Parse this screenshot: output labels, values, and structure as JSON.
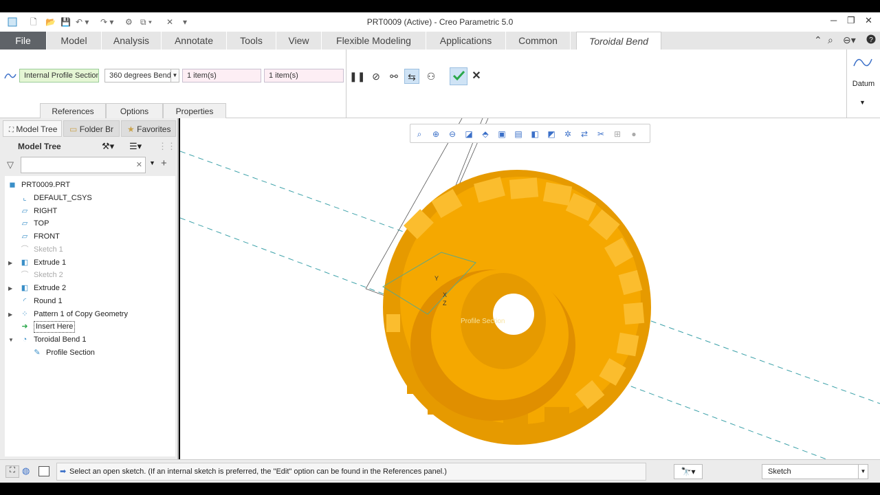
{
  "window": {
    "title": "PRT0009 (Active) - Creo Parametric 5.0"
  },
  "ribbon": {
    "file_tab": "File",
    "tabs": [
      "Model",
      "Analysis",
      "Annotate",
      "Tools",
      "View",
      "Flexible Modeling",
      "Applications",
      "Common"
    ],
    "active_tab": "Toroidal Bend"
  },
  "dashboard": {
    "profile_type": "Internal Profile Section",
    "bend_angle": "360 degrees Bend",
    "collector_1": "1 item(s)",
    "collector_2": "1 item(s)",
    "sub_tabs": [
      "References",
      "Options",
      "Properties"
    ],
    "datum_label": "Datum"
  },
  "panel": {
    "tabs": [
      "Model Tree",
      "Folder Br",
      "Favorites"
    ],
    "header": "Model Tree",
    "search_value": "",
    "tree": [
      {
        "label": "PRT0009.PRT",
        "icon": "part-icon",
        "expand": "",
        "dim": false,
        "indent": 0
      },
      {
        "label": "DEFAULT_CSYS",
        "icon": "csys-icon",
        "expand": "",
        "dim": false,
        "indent": 1
      },
      {
        "label": "RIGHT",
        "icon": "datum-plane-icon",
        "expand": "",
        "dim": false,
        "indent": 1
      },
      {
        "label": "TOP",
        "icon": "datum-plane-icon",
        "expand": "",
        "dim": false,
        "indent": 1
      },
      {
        "label": "FRONT",
        "icon": "datum-plane-icon",
        "expand": "",
        "dim": false,
        "indent": 1
      },
      {
        "label": "Sketch 1",
        "icon": "sketch-icon",
        "expand": "",
        "dim": true,
        "indent": 1
      },
      {
        "label": "Extrude 1",
        "icon": "extrude-icon",
        "expand": "▶",
        "dim": false,
        "indent": 1
      },
      {
        "label": "Sketch 2",
        "icon": "sketch-icon",
        "expand": "",
        "dim": true,
        "indent": 1
      },
      {
        "label": "Extrude 2",
        "icon": "extrude-icon",
        "expand": "▶",
        "dim": false,
        "indent": 1
      },
      {
        "label": "Round 1",
        "icon": "round-icon",
        "expand": "",
        "dim": false,
        "indent": 1
      },
      {
        "label": "Pattern 1 of Copy Geometry",
        "icon": "pattern-icon",
        "expand": "▶",
        "dim": false,
        "indent": 1
      },
      {
        "label": "Insert Here",
        "icon": "insert-arrow-icon",
        "expand": "",
        "dim": false,
        "indent": 1
      },
      {
        "label": "Toroidal Bend 1",
        "icon": "toroidal-bend-icon",
        "expand": "▼",
        "dim": false,
        "indent": 1
      },
      {
        "label": "Profile Section",
        "icon": "sketch-edit-icon",
        "expand": "",
        "dim": false,
        "indent": 2
      }
    ]
  },
  "viewport": {
    "annotation": "Profile Section",
    "axis_labels": [
      "Y",
      "X",
      "Z"
    ],
    "model_color": "#f5a800"
  },
  "status": {
    "message": "Select an open sketch. (If an internal sketch is preferred, the \"Edit\" option can be found in the References panel.)",
    "filter_value": "Sketch"
  },
  "colors": {
    "accent": "#3a6fc8",
    "confirm": "#2aa84a",
    "ribbon_bg": "#e6e6e6"
  }
}
